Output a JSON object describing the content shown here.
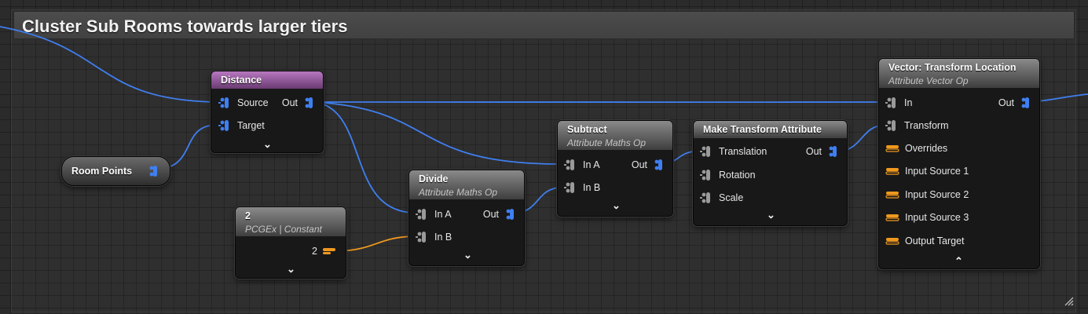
{
  "comment": {
    "title": "Cluster Sub Rooms towards larger tiers"
  },
  "nodes": {
    "distance": {
      "title": "Distance",
      "pins": {
        "source": "Source",
        "target": "Target",
        "out": "Out"
      }
    },
    "room_points": {
      "title": "Room Points"
    },
    "constant": {
      "title": "2",
      "subtitle": "PCGEx | Constant",
      "value": "2"
    },
    "divide": {
      "title": "Divide",
      "subtitle": "Attribute Maths Op",
      "pins": {
        "in_a": "In A",
        "in_b": "In B",
        "out": "Out"
      }
    },
    "subtract": {
      "title": "Subtract",
      "subtitle": "Attribute Maths Op",
      "pins": {
        "in_a": "In A",
        "in_b": "In B",
        "out": "Out"
      }
    },
    "make_transform": {
      "title": "Make Transform Attribute",
      "pins": {
        "translation": "Translation",
        "rotation": "Rotation",
        "scale": "Scale",
        "out": "Out"
      }
    },
    "vector_transform": {
      "title": "Vector: Transform Location",
      "subtitle": "Attribute Vector Op",
      "pins": {
        "in": "In",
        "transform": "Transform",
        "overrides": "Overrides",
        "input_source_1": "Input Source 1",
        "input_source_2": "Input Source 2",
        "input_source_3": "Input Source 3",
        "output_target": "Output Target",
        "out": "Out"
      }
    }
  },
  "colors": {
    "point_wire": "#3f7ff0",
    "param_wire": "#f0981e",
    "distance_header": "#9a5aa3",
    "generic_header": "#7c7c7c"
  }
}
